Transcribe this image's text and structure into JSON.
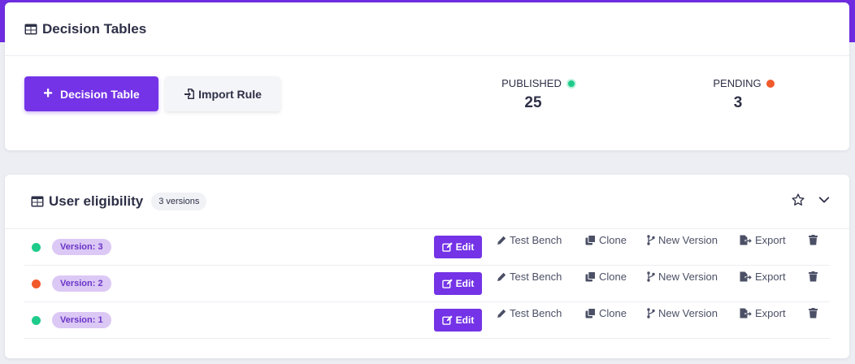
{
  "header": {
    "title": "Decision Tables",
    "add_button_label": "Decision Table",
    "import_button_label": "Import Rule"
  },
  "stats": {
    "published": {
      "label": "PUBLISHED",
      "value": "25",
      "color": "#1ecb8a"
    },
    "pending": {
      "label": "PENDING",
      "value": "3",
      "color": "#f15a2b"
    }
  },
  "table": {
    "title": "User eligibility",
    "versions_badge": "3 versions",
    "rows": [
      {
        "status_color": "#1ecb8a",
        "version": "Version: 3"
      },
      {
        "status_color": "#f15a2b",
        "version": "Version: 2"
      },
      {
        "status_color": "#1ecb8a",
        "version": "Version: 1"
      }
    ],
    "actions": {
      "edit": "Edit",
      "test_bench": "Test Bench",
      "clone": "Clone",
      "new_version": "New Version",
      "export": "Export"
    }
  },
  "colors": {
    "accent": "#7433e6",
    "topbar": "#6f2ce0"
  }
}
